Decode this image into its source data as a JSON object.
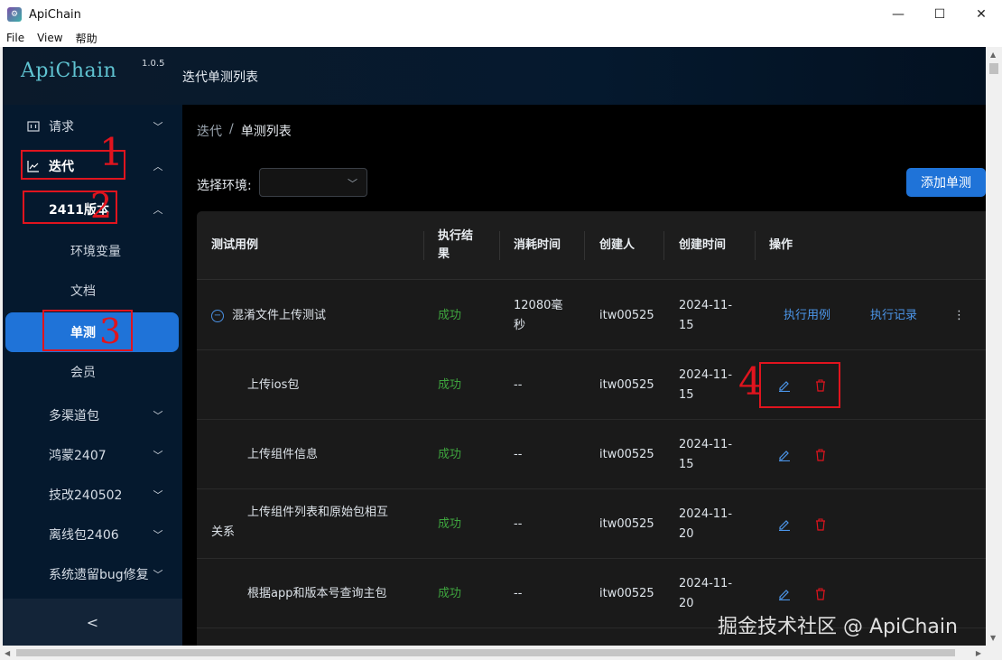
{
  "window": {
    "title": "ApiChain",
    "minimize": "—",
    "maximize": "☐",
    "close": "✕"
  },
  "menubar": [
    "File",
    "View",
    "帮助"
  ],
  "header": {
    "logo": "ApiChain",
    "version": "1.0.5",
    "page_title": "迭代单测列表"
  },
  "sidebar": {
    "items": [
      {
        "label": "请求",
        "icon": "request-icon",
        "expanded": false
      },
      {
        "label": "迭代",
        "icon": "chart-line-icon",
        "expanded": true
      },
      {
        "label": "2411版本",
        "expanded": true
      },
      {
        "label": "环境变量"
      },
      {
        "label": "文档"
      },
      {
        "label": "单测",
        "active": true
      },
      {
        "label": "会员"
      },
      {
        "label": "多渠道包",
        "expanded": false
      },
      {
        "label": "鸿蒙2407",
        "expanded": false
      },
      {
        "label": "技改240502",
        "expanded": false
      },
      {
        "label": "离线包2406",
        "expanded": false
      },
      {
        "label": "系统遗留bug修复",
        "expanded": false
      }
    ],
    "collapse": "<"
  },
  "breadcrumb": {
    "parent": "迭代",
    "separator": "/",
    "current": "单测列表"
  },
  "env": {
    "label": "选择环境:",
    "value": ""
  },
  "add_button": "添加单测",
  "table": {
    "headers": [
      "测试用例",
      "执行结果",
      "消耗时间",
      "创建人",
      "创建时间",
      "操作"
    ],
    "rows": [
      {
        "name": "混淆文件上传测试",
        "result": "成功",
        "duration": "12080毫秒",
        "creator": "itw00525",
        "created": "2024-11-15",
        "action1": "执行用例",
        "action2": "执行记录",
        "more": "⋮"
      },
      {
        "name": "上传ios包",
        "result": "成功",
        "duration": "--",
        "creator": "itw00525",
        "created": "2024-11-15"
      },
      {
        "name": "上传组件信息",
        "result": "成功",
        "duration": "--",
        "creator": "itw00525",
        "created": "2024-11-15"
      },
      {
        "name_line1": "上传组件列表和原始包相互",
        "name_line2": "关系",
        "result": "成功",
        "duration": "--",
        "creator": "itw00525",
        "created": "2024-11-20"
      },
      {
        "name": "根据app和版本号查询主包",
        "result": "成功",
        "duration": "--",
        "creator": "itw00525",
        "created": "2024-11-20"
      }
    ]
  },
  "annotations": [
    "1",
    "2",
    "3",
    "4"
  ],
  "watermark": "掘金技术社区 @ ApiChain",
  "colors": {
    "accent": "#1f73d8",
    "success": "#3ea43e",
    "link": "#4c96ea",
    "danger": "#e0141e",
    "sidebar_bg": "#05192e"
  }
}
